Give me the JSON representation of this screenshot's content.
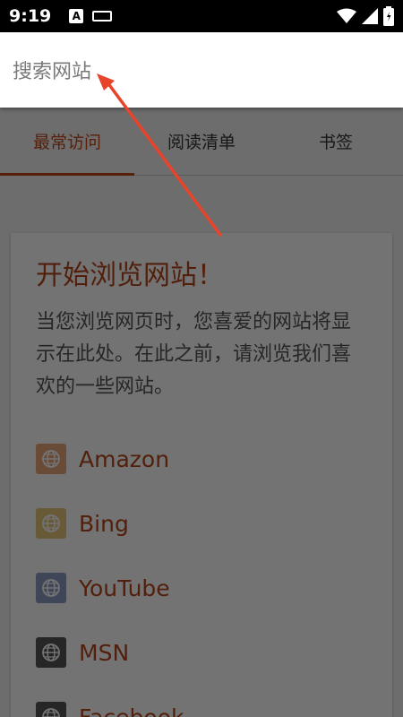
{
  "status_bar": {
    "time": "9:19",
    "notification_icons": [
      "text-a-icon",
      "keyboard-icon"
    ],
    "system_icons": [
      "wifi-icon",
      "signal-icon",
      "battery-icon"
    ]
  },
  "search": {
    "placeholder": "搜索网站"
  },
  "tabs": [
    {
      "label": "最常访问",
      "active": true
    },
    {
      "label": "阅读清单",
      "active": false
    },
    {
      "label": "书签",
      "active": false
    }
  ],
  "card": {
    "title": "开始浏览网站！",
    "description": "当您浏览网页时，您喜爱的网站将显示在此处。在此之前，请浏览我们喜欢的一些网站。",
    "sites": [
      {
        "label": "Amazon",
        "icon": "globe-icon",
        "color": "#e8a77a"
      },
      {
        "label": "Bing",
        "icon": "globe-icon",
        "color": "#e8c77a"
      },
      {
        "label": "YouTube",
        "icon": "globe-icon",
        "color": "#8a9cc4"
      },
      {
        "label": "MSN",
        "icon": "globe-icon",
        "color": "#555555"
      },
      {
        "label": "Facebook",
        "icon": "globe-icon",
        "color": "#555555"
      }
    ]
  },
  "colors": {
    "accent": "#c0471a",
    "overlay": "rgba(0,0,0,0.55)",
    "arrow": "#e8432b"
  }
}
